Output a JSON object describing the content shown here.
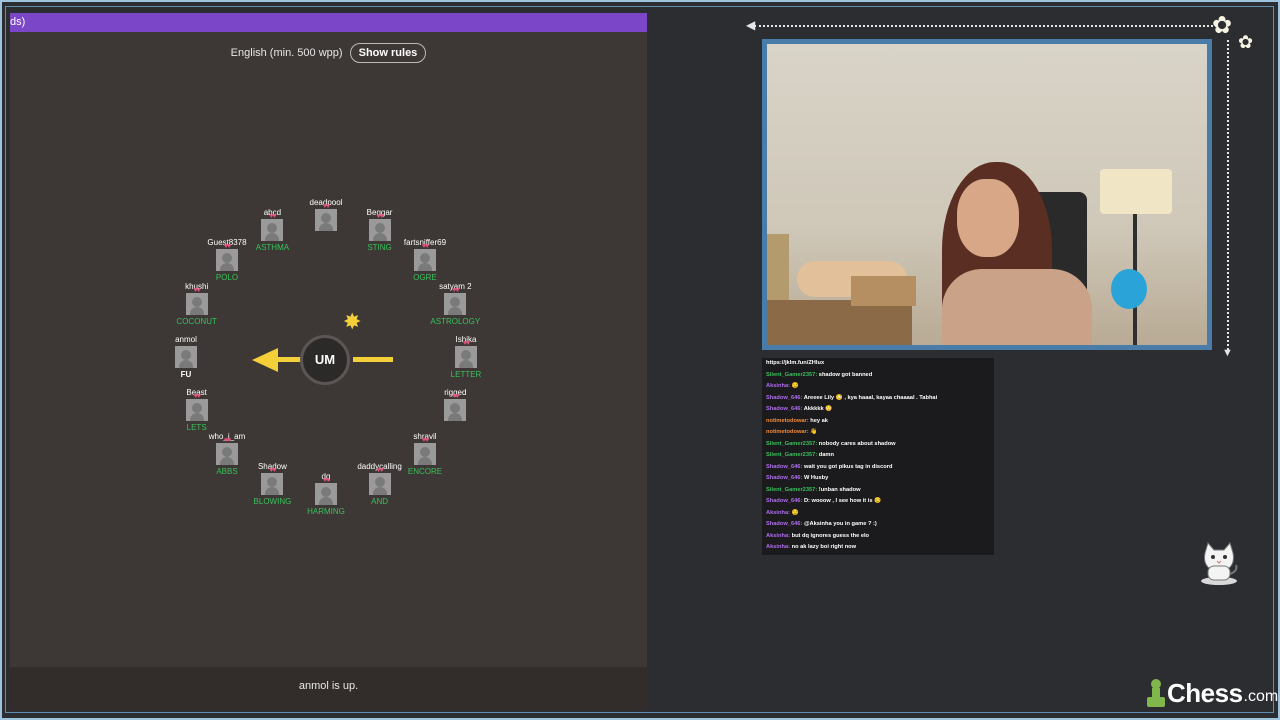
{
  "game": {
    "top_bar_text": "ds)",
    "language_label": "English (min. 500 wpp)",
    "rules_button": "Show rules",
    "status_text": "anmol is up.",
    "bomb_syllable": "UM",
    "players": [
      {
        "name": "deadpool",
        "word": ""
      },
      {
        "name": "Beggar",
        "word": "STING"
      },
      {
        "name": "fartsniffer69",
        "word": "OGRE"
      },
      {
        "name": "satyam 2",
        "word": "ASTROLOGY"
      },
      {
        "name": "Ishika",
        "word": "LETTER"
      },
      {
        "name": "rigged",
        "word": ""
      },
      {
        "name": "shravil",
        "word": "ENCORE"
      },
      {
        "name": "daddycalling",
        "word": "AND"
      },
      {
        "name": "dq",
        "word": "HARMING"
      },
      {
        "name": "Shadow",
        "word": "BLOWING"
      },
      {
        "name": "who_i_am",
        "word": "ABBS"
      },
      {
        "name": "Beast",
        "word": "LETS"
      },
      {
        "name": "anmol",
        "word": "FU"
      },
      {
        "name": "khushi",
        "word": "COCONUT"
      },
      {
        "name": "Guest8378",
        "word": "POLO"
      },
      {
        "name": "abcd",
        "word": "ASTHMA"
      }
    ]
  },
  "chat": {
    "messages": [
      {
        "user": "",
        "text": "https://jklm.fun/ZHlux",
        "color": "#b06cf0"
      },
      {
        "user": "Silent_Gamer2357:",
        "text": "shadow got banned",
        "color": "#38c05a"
      },
      {
        "user": "Aksinha:",
        "text": "😏",
        "color": "#b06cf0"
      },
      {
        "user": "Shadow_646:",
        "text": "Areeee Lily 😳 , kya haaal, kayaa chaaaal . Tabhai",
        "color": "#b06cf0"
      },
      {
        "user": "Shadow_646:",
        "text": "Akkkkk 😳",
        "color": "#b06cf0"
      },
      {
        "user": "notimetodowar:",
        "text": "hey ak",
        "color": "#f08a3c"
      },
      {
        "user": "notimetodowar:",
        "text": "👋",
        "color": "#f08a3c"
      },
      {
        "user": "Silent_Gamer2357:",
        "text": "nobody cares about shadow",
        "color": "#38c05a"
      },
      {
        "user": "Silent_Gamer2357:",
        "text": "damn",
        "color": "#38c05a"
      },
      {
        "user": "Shadow_646:",
        "text": "wait you got pikus tag in discord",
        "color": "#b06cf0"
      },
      {
        "user": "Shadow_646:",
        "text": "W Husby",
        "color": "#b06cf0"
      },
      {
        "user": "Silent_Gamer2357:",
        "text": "!unban shadow",
        "color": "#38c05a"
      },
      {
        "user": "Shadow_646:",
        "text": "D: wooow , I see how it is 😒",
        "color": "#b06cf0"
      },
      {
        "user": "Aksinha:",
        "text": "😏",
        "color": "#b06cf0"
      },
      {
        "user": "Shadow_646:",
        "text": "@Aksinha you in game ? :)",
        "color": "#b06cf0"
      },
      {
        "user": "Aksinha:",
        "text": "but dq ignores guess the elo",
        "color": "#b06cf0"
      },
      {
        "user": "Aksinha:",
        "text": "no ak lazy boi right now",
        "color": "#b06cf0"
      }
    ]
  },
  "branding": {
    "logo_text": "Chess",
    "logo_tld": ".com",
    "accent": "#81b64c"
  }
}
